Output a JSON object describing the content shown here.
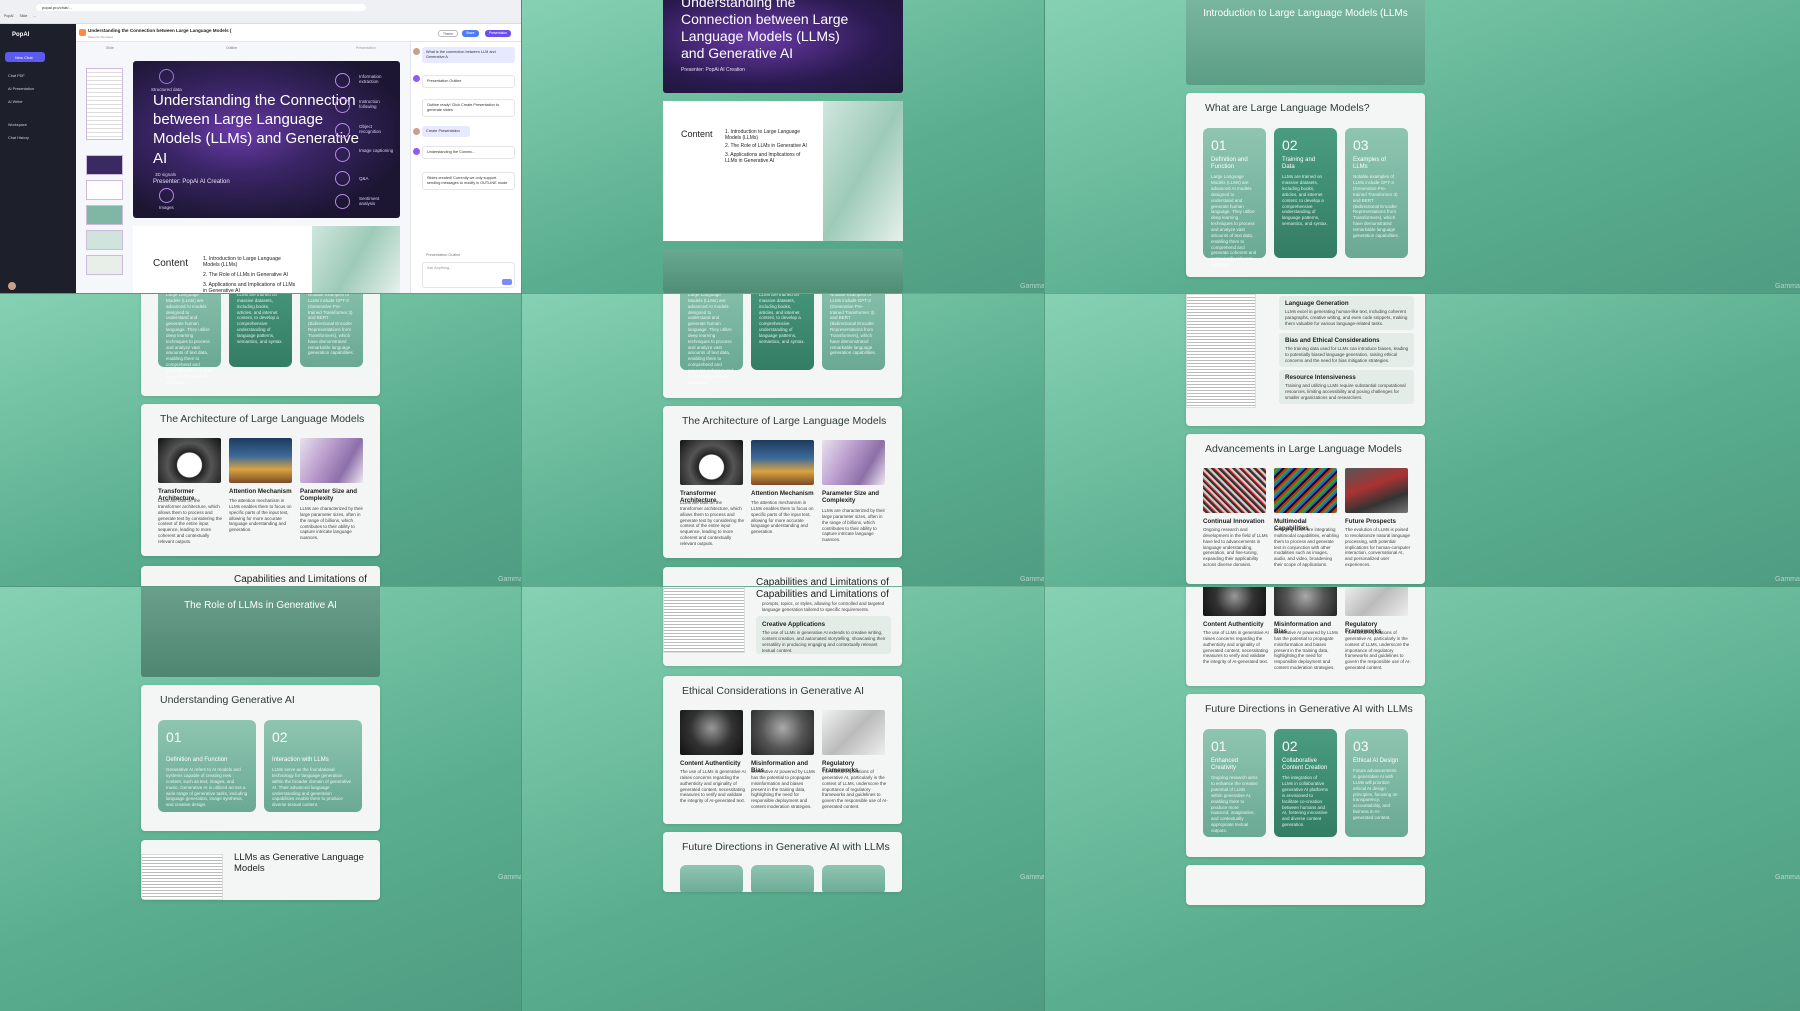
{
  "app": {
    "url": "popai.pro/chat/...",
    "browser_tabs": [
      "PopAI",
      "Slide",
      "...",
      "",
      "",
      "",
      "",
      ""
    ],
    "sidebar": {
      "logo": "PopAI",
      "new_chat": "New Chat",
      "items": [
        "Chat PDF",
        "AI Presentation",
        "AI Writer",
        "Workspace",
        "Chat History"
      ]
    },
    "deck": {
      "title": "Understanding the Connection between Large Language Models (",
      "subtitle": "Saved to the cloud",
      "buttons": [
        "Theme",
        "Share",
        "Presentation"
      ],
      "tabs": [
        "Slide",
        "Outline",
        "Presentation"
      ]
    },
    "slide1": {
      "title": "Understanding the Connection between Large Language Models (LLMs) and Generative AI",
      "presenter": "Presenter: PopAi AI Creation",
      "labels_left": [
        "Structured data",
        "3D signals",
        "Images"
      ],
      "labels_right": [
        "Information extraction",
        "Instruction following",
        "Object recognition",
        "Image captioning",
        "Q&A",
        "Sentiment analysis"
      ]
    },
    "slide2": {
      "heading": "Content",
      "items": [
        "1. Introduction to Large Language Models (LLMs)",
        "2. The Role of LLMs in Generative AI",
        "3. Applications and Implications of LLMs in Generative AI"
      ]
    },
    "chat": {
      "messages": [
        "What is the connection between LLM and Generative A",
        "Presentation Outline",
        "Outline ready! Click Create Presentation to generate slides",
        "Create Presentation",
        "Understanding the Connec...",
        "Slides created! Currently we only support sending messages to modify in OUTLINE mode"
      ],
      "bottom_chip": "Presentation Outline",
      "input_placeholder": "Ask Anything..."
    }
  },
  "watermark": "Gamma",
  "slides": {
    "intro_banner": "Introduction to Large Language Models (LLMs",
    "what_are": {
      "title": "What are Large Language Models?",
      "cards": [
        {
          "num": "01",
          "title": "Definition and Function",
          "text": "Large Language Models (LLMs) are advanced AI models designed to understand and generate human language. They utilize deep learning techniques to process and analyze vast amounts of text data, enabling them to comprehend and generate coherent and contextually relevant language."
        },
        {
          "num": "02",
          "title": "Training and Data",
          "text": "LLMs are trained on massive datasets, including books, articles, and internet content, to develop a comprehensive understanding of language patterns, semantics, and syntax."
        },
        {
          "num": "03",
          "title": "Examples of LLMs",
          "text": "Notable examples of LLMs include GPT-3 (Generative Pre-trained Transformer 3) and BERT (Bidirectional Encoder Representations from Transformers), which have demonstrated remarkable language generation capabilities."
        }
      ]
    },
    "architecture": {
      "title": "The Architecture of Large Language Models",
      "items": [
        {
          "title": "Transformer Architecture",
          "text": "LLMs are built on the transformer architecture, which allows them to process and generate text by considering the context of the entire input sequence, leading to more coherent and contextually relevant outputs."
        },
        {
          "title": "Attention Mechanism",
          "text": "The attention mechanism in LLMs enables them to focus on specific parts of the input text, allowing for more accurate language understanding and generation."
        },
        {
          "title": "Parameter Size and Complexity",
          "text": "LLMs are characterized by their large parameter sizes, often in the range of billions, which contributes to their ability to capture intricate language nuances."
        }
      ]
    },
    "capabilities_title": "Capabilities and Limitations of",
    "role_banner": "The Role of LLMs in Generative AI",
    "understanding_gen": {
      "title": "Understanding Generative AI",
      "cards": [
        {
          "num": "01",
          "title": "Definition and Function",
          "text": "Generative AI refers to AI models and systems capable of creating new content, such as text, images, and music. Generative AI is utilized across a wide range of generative tasks, including language generation, image synthesis, and creative design."
        },
        {
          "num": "02",
          "title": "Interaction with LLMs",
          "text": "LLMs serve as the foundational technology for language generation within the broader domain of generative AI. Their advanced language understanding and generation capabilities enable them to produce diverse textual content."
        }
      ]
    },
    "llms_as_gen": "LLMs as Generative Language Models",
    "capabilities_right": {
      "items": [
        {
          "title": "Language Generation",
          "text": "LLMs excel in generating human-like text, including coherent paragraphs, creative writing, and even code snippets, making them valuable for various language-related tasks."
        },
        {
          "title": "Bias and Ethical Considerations",
          "text": "The training data used for LLMs can introduce biases, leading to potentially biased language generation, raising ethical concerns and the need for bias mitigation strategies."
        },
        {
          "title": "Resource Intensiveness",
          "text": "Training and utilizing LLMs require substantial computational resources, limiting accessibility and posing challenges for smaller organizations and researchers."
        }
      ]
    },
    "creative_apps": {
      "lead": "prompts, topics, or styles, allowing for controlled and targeted language generation tailored to specific requirements.",
      "title": "Creative Applications",
      "text": "The use of LLMs in generative AI extends to creative writing, content creation, and automated storytelling, showcasing their versatility in producing engaging and contextually relevant textual content."
    },
    "advancements": {
      "title": "Advancements in Large Language Models",
      "items": [
        {
          "title": "Continual Innovation",
          "text": "Ongoing research and development in the field of LLMs have led to advancements in language understanding, generation, and fine-tuning, expanding their applicability across diverse domains."
        },
        {
          "title": "Multimodal Capabilities",
          "text": "Emerging LLMs are integrating multimodal capabilities, enabling them to process and generate text in conjunction with other modalities such as images, audio, and video, broadening their scope of applications."
        },
        {
          "title": "Future Prospects",
          "text": "The evolution of LLMs is poised to revolutionize natural language processing, with potential implications for human-computer interaction, conversational AI, and personalized user experiences."
        }
      ]
    },
    "ethical": {
      "title": "Ethical Considerations in Generative AI",
      "items": [
        {
          "title": "Content Authenticity",
          "text": "The use of LLMs in generative AI raises concerns regarding the authenticity and originality of generated content, necessitating measures to verify and validate the integrity of AI-generated text."
        },
        {
          "title": "Misinformation and Bias",
          "text": "Generative AI powered by LLMs has the potential to propagate misinformation and biases present in the training data, highlighting the need for responsible deployment and content moderation strategies."
        },
        {
          "title": "Regulatory Frameworks",
          "text": "The ethical implications of generative AI, particularly in the context of LLMs, underscore the importance of regulatory frameworks and guidelines to govern the responsible use of AI-generated content."
        }
      ]
    },
    "future": {
      "title": "Future Directions in Generative AI with LLMs",
      "cards": [
        {
          "num": "01",
          "title": "Enhanced Creativity",
          "text": "Ongoing research aims to enhance the creative potential of LLMs within generative AI, enabling them to produce more nuanced, imaginative, and contextually appropriate textual outputs."
        },
        {
          "num": "02",
          "title": "Collaborative Content Creation",
          "text": "The integration of LLMs in collaborative generative AI platforms is envisioned to facilitate co-creation between humans and AI, fostering innovative and diverse content generation."
        },
        {
          "num": "03",
          "title": "Ethical AI Design",
          "text": "Future advancements in generative AI with LLMs will prioritize ethical AI design principles, focusing on transparency, accountability, and fairness in AI-generated content."
        }
      ]
    }
  }
}
